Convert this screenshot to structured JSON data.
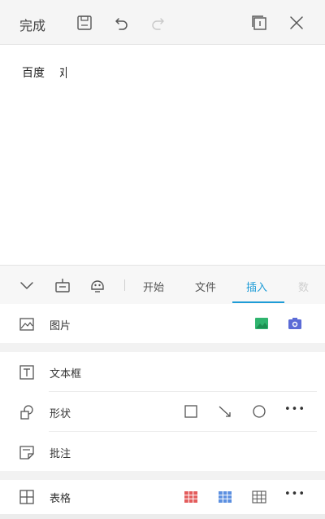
{
  "toolbar": {
    "done_label": "完成",
    "icons": [
      "save-icon",
      "undo-icon",
      "redo-icon",
      "page-view-icon",
      "close-icon"
    ]
  },
  "document": {
    "text": "百度",
    "after_gap_glyph": "ﾇ"
  },
  "bottom_panel": {
    "tabs": [
      {
        "label": "开始",
        "active": false
      },
      {
        "label": "文件",
        "active": false
      },
      {
        "label": "插入",
        "active": true
      },
      {
        "label": "数",
        "active": false
      }
    ],
    "accent_color": "#1e9cd7",
    "items": [
      {
        "label": "图片",
        "icon": "picture-icon"
      },
      {
        "label": "文本框",
        "icon": "textbox-icon"
      },
      {
        "label": "形状",
        "icon": "shape-icon"
      },
      {
        "label": "批注",
        "icon": "comment-icon"
      },
      {
        "label": "表格",
        "icon": "table-icon"
      }
    ],
    "more_label": "•••"
  }
}
